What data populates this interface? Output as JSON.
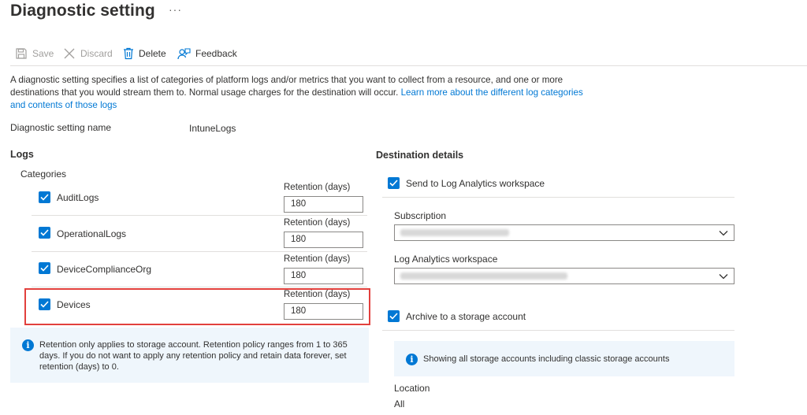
{
  "page": {
    "title": "Diagnostic setting",
    "more": "···"
  },
  "toolbar": {
    "save_label": "Save",
    "discard_label": "Discard",
    "delete_label": "Delete",
    "feedback_label": "Feedback"
  },
  "description": {
    "text": "A diagnostic setting specifies a list of categories of platform logs and/or metrics that you want to collect from a resource, and one or more destinations that you would stream them to. Normal usage charges for the destination will occur. ",
    "link": "Learn more about the different log categories and contents of those logs"
  },
  "setting_name": {
    "label": "Diagnostic setting name",
    "value": "IntuneLogs"
  },
  "logs": {
    "title": "Logs",
    "categories_label": "Categories",
    "retention_label": "Retention (days)",
    "items": [
      {
        "label": "AuditLogs",
        "checked": true,
        "retention": "180"
      },
      {
        "label": "OperationalLogs",
        "checked": true,
        "retention": "180"
      },
      {
        "label": "DeviceComplianceOrg",
        "checked": true,
        "retention": "180"
      },
      {
        "label": "Devices",
        "checked": true,
        "retention": "180"
      }
    ],
    "info": "Retention only applies to storage account. Retention policy ranges from 1 to 365 days. If you do not want to apply any retention policy and retain data forever, set retention (days) to 0."
  },
  "destination": {
    "title": "Destination details",
    "log_analytics_label": "Send to Log Analytics workspace",
    "subscription_label": "Subscription",
    "workspace_label": "Log Analytics workspace",
    "archive_label": "Archive to a storage account",
    "storage_info": "Showing all storage accounts including classic storage accounts",
    "location_label": "Location",
    "location_value": "All"
  },
  "colors": {
    "accent": "#0078d4",
    "highlight": "#e2403d",
    "info_bg": "#eff6fc"
  },
  "icons": [
    "save-icon",
    "discard-icon",
    "delete-icon",
    "feedback-icon",
    "info-icon",
    "checkmark-icon",
    "chevron-down-icon"
  ]
}
